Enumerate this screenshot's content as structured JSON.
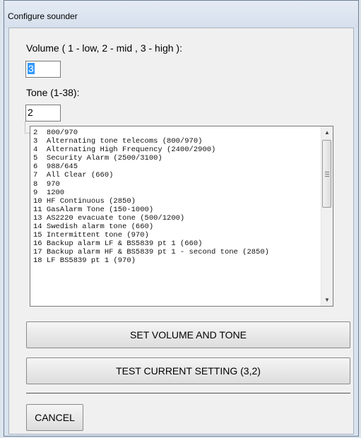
{
  "window": {
    "title": "Configure sounder"
  },
  "volume": {
    "label": "Volume ( 1 - low, 2 - mid , 3 - high ):",
    "value": "3"
  },
  "tone": {
    "label": "Tone (1-38):",
    "value": "2"
  },
  "tone_list": {
    "items": [
      "2  800/970",
      "3  Alternating tone telecoms (800/970)",
      "4  Alternating High Frequency (2400/2900)",
      "5  Security Alarm (2500/3100)",
      "6  988/645",
      "7  All Clear (660)",
      "8  970",
      "9  1200",
      "10 HF Continuous (2850)",
      "11 GasAlarm Tone (150-1000)",
      "13 AS2220 evacuate tone (500/1200)",
      "14 Swedish alarm tone (660)",
      "15 Intermittent tone (970)",
      "16 Backup alarm LF & BS5839 pt 1 (660)",
      "17 Backup alarm HF & BS5839 pt 1 - second tone (2850)",
      "18 LF BS5839 pt 1 (970)"
    ]
  },
  "buttons": {
    "set": "SET VOLUME AND TONE",
    "test": "TEST CURRENT SETTING (3,2)",
    "cancel": "CANCEL"
  }
}
